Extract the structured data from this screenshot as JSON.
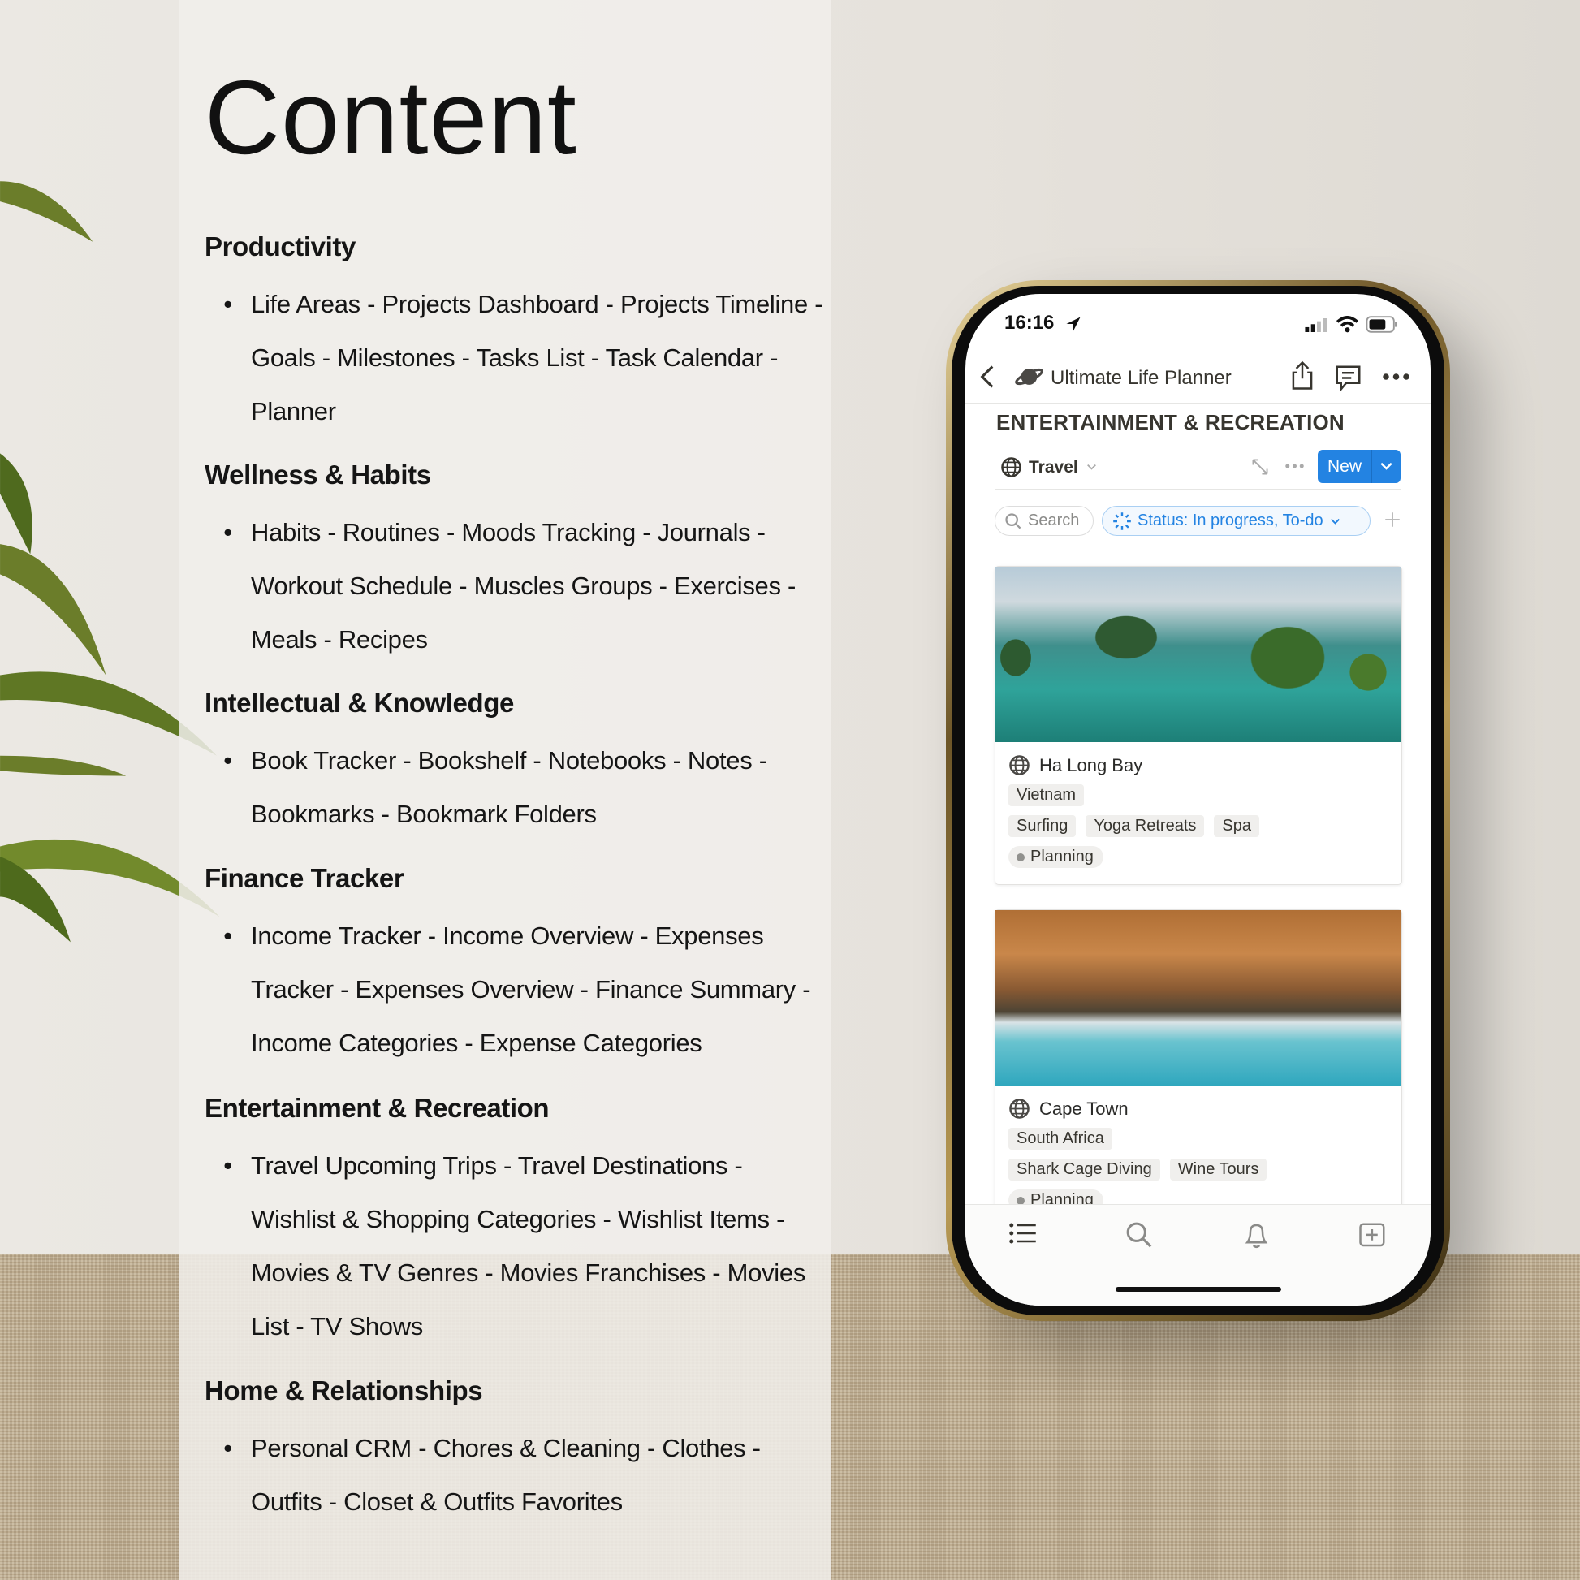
{
  "page": {
    "title": "Content"
  },
  "sections": [
    {
      "heading": "Productivity",
      "text": "Life Areas - Projects Dashboard - Projects Timeline - Goals - Milestones - Tasks List - Task Calendar - Planner"
    },
    {
      "heading": "Wellness & Habits",
      "text": "Habits - Routines - Moods Tracking - Journals - Workout Schedule - Muscles Groups - Exercises - Meals - Recipes"
    },
    {
      "heading": "Intellectual & Knowledge",
      "text": "Book Tracker - Bookshelf - Notebooks - Notes - Bookmarks - Bookmark Folders"
    },
    {
      "heading": "Finance Tracker",
      "text": "Income Tracker - Income Overview - Expenses Tracker - Expenses Overview - Finance Summary - Income Categories - Expense Categories"
    },
    {
      "heading": "Entertainment & Recreation",
      "text": "Travel Upcoming Trips - Travel Destinations - Wishlist & Shopping Categories - Wishlist Items - Movies & TV Genres - Movies Franchises - Movies List - TV Shows"
    },
    {
      "heading": "Home & Relationships",
      "text": "Personal CRM - Chores & Cleaning - Clothes - Outfits - Closet & Outfits Favorites"
    }
  ],
  "bullet": "•",
  "phone": {
    "status_time": "16:16",
    "nav_title": "Ultimate Life Planner",
    "page_heading": "ENTERTAINMENT & RECREATION",
    "view_name": "Travel",
    "new_label": "New",
    "search_label": "Search",
    "filter_label": "Status: In progress, To-do",
    "accent": "#2383e2",
    "cards": [
      {
        "name": "Ha Long Bay",
        "country": "Vietnam",
        "activities": [
          "Surfing",
          "Yoga Retreats",
          "Spa"
        ],
        "status": "Planning"
      },
      {
        "name": "Cape Town",
        "country": "South Africa",
        "activities": [
          "Shark Cage Diving",
          "Wine Tours"
        ],
        "status": "Planning"
      }
    ],
    "tabbar_icons": [
      "list-icon",
      "search-icon",
      "bell-icon",
      "new-page-icon"
    ]
  }
}
